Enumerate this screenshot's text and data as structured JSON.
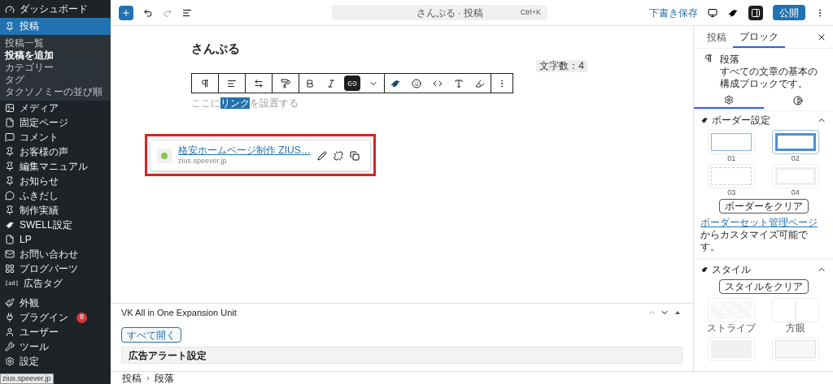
{
  "admin_menu": [
    {
      "label": "ダッシュボード",
      "selected": false
    },
    {
      "label": "投稿",
      "selected": true,
      "children": [
        {
          "label": "投稿一覧",
          "selected": false
        },
        {
          "label": "投稿を追加",
          "selected": true
        },
        {
          "label": "カテゴリー",
          "selected": false
        },
        {
          "label": "タグ",
          "selected": false
        },
        {
          "label": "タクソノミーの並び順",
          "selected": false
        }
      ]
    },
    {
      "label": "メディア",
      "selected": false
    },
    {
      "label": "固定ページ",
      "selected": false
    },
    {
      "label": "コメント",
      "selected": false
    },
    {
      "label": "お客様の声",
      "selected": false
    },
    {
      "label": "編集マニュアル",
      "selected": false
    },
    {
      "label": "お知らせ",
      "selected": false
    },
    {
      "label": "ふきだし",
      "selected": false
    },
    {
      "label": "制作実績",
      "selected": false
    },
    {
      "label": "SWELL設定",
      "selected": false
    },
    {
      "label": "LP",
      "selected": false
    },
    {
      "label": "お問い合わせ",
      "selected": false
    },
    {
      "label": "ブログパーツ",
      "selected": false
    },
    {
      "label": "広告タグ",
      "icon_text": "[ad]",
      "selected": false
    },
    {
      "label": "外観",
      "selected": false
    },
    {
      "label": "プラグイン",
      "selected": false,
      "badge": "8"
    },
    {
      "label": "ユーザー",
      "selected": false
    },
    {
      "label": "ツール",
      "selected": false
    },
    {
      "label": "設定",
      "selected": false
    }
  ],
  "status_url": "zius.speever.jp",
  "top_bar": {
    "command": {
      "title": "さんぷる · 投稿",
      "shortcut": "Ctrl+K"
    },
    "save_draft": "下書き保存",
    "publish": "公開",
    "settings_open": true
  },
  "editor": {
    "title": "さんぷる",
    "char_count": "文字数：4",
    "paragraph": {
      "before": "ここに",
      "selected": "リンク",
      "after": "を設置する"
    },
    "toolbar": [
      {
        "selected": false
      },
      {
        "selected": false
      },
      {
        "selected": false
      },
      {
        "selected": false
      },
      {
        "selected": false
      },
      {
        "selected": false
      },
      {
        "selected": true
      },
      {
        "selected": false
      },
      {
        "selected": false
      },
      {
        "selected": false
      },
      {
        "selected": false
      },
      {
        "selected": false
      },
      {
        "selected": false
      },
      {
        "selected": false
      }
    ],
    "link_popover": {
      "title": "格安ホームページ制作 ZIUS…",
      "url": "zius.speever.jp"
    }
  },
  "meta_box": {
    "title": "VK All in One Expansion Unit",
    "open_all": "すべて開く",
    "rows": [
      "広告アラート設定"
    ]
  },
  "breadcrumb": [
    "投稿",
    "段落"
  ],
  "settings_panel": {
    "tabs": [
      {
        "label": "投稿",
        "selected": false
      },
      {
        "label": "ブロック",
        "selected": true
      }
    ],
    "block": {
      "name": "段落",
      "description": "すべての文章の基本の構成ブロックです。"
    },
    "sub_tabs": [
      {
        "selected": true
      },
      {
        "selected": false
      }
    ],
    "border_section": {
      "title": "ボーダー設定",
      "presets": [
        {
          "label": "01",
          "kind": "thin",
          "selected": false
        },
        {
          "label": "02",
          "kind": "thick",
          "selected": true
        },
        {
          "label": "03",
          "kind": "dashed",
          "selected": false
        },
        {
          "label": "04",
          "kind": "double",
          "selected": false
        }
      ],
      "clear": "ボーダーをクリア",
      "link": "ボーダーセット管理ページ",
      "note": "からカスタマイズ可能です。"
    },
    "style_section": {
      "title": "スタイル",
      "clear": "スタイルをクリア",
      "presets": [
        {
          "label": "ストライプ",
          "kind": "stripe"
        },
        {
          "label": "方眼",
          "kind": "grid"
        },
        {
          "kind": "corner"
        },
        {
          "kind": "dotted"
        }
      ]
    }
  }
}
